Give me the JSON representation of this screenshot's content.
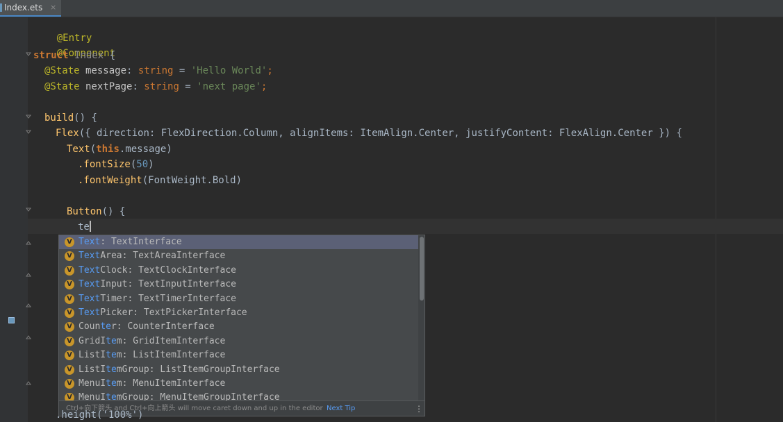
{
  "tab": {
    "filename": "Index.ets",
    "close": "×"
  },
  "code": {
    "line1": "@Entry",
    "line2": "@Component",
    "struct_kw": "struct",
    "struct_name": "Index",
    "struct_open": " {",
    "state_decorator": "@State",
    "message_name": " message",
    "colon_string": ": ",
    "string_type": "string",
    "eq": " = ",
    "message_value": "'Hello World'",
    "semicolon": ";",
    "next_name": " nextPage",
    "next_value": "'next page'",
    "build_fn": "build",
    "build_rest": "() {",
    "flex_line": {
      "flex": "Flex",
      "open": "({ ",
      "direction_key": "direction",
      "direction_val": ": FlexDirection.Column, ",
      "align_key": "alignItems",
      "align_val": ": ItemAlign.Center, ",
      "justify_key": "justifyContent",
      "justify_val": ": FlexAlign.Center ",
      "close": "}) {"
    },
    "text_fn": "Text",
    "text_open": "(",
    "this_kw": "this",
    "text_arg": ".message)",
    "font_size_fn": ".fontSize",
    "font_size_open": "(",
    "font_size_val": "50",
    "font_size_close": ")",
    "font_weight_fn": ".fontWeight",
    "font_weight_arg": "(FontWeight.Bold)",
    "button_fn": "Button",
    "button_rest": "() {",
    "typed": "te",
    "partial_line": ".height('100%')"
  },
  "completion": {
    "items": [
      {
        "match": "Text",
        "rest": ": TextInterface"
      },
      {
        "match": "Text",
        "rest": "Area: TextAreaInterface"
      },
      {
        "match": "Text",
        "rest": "Clock: TextClockInterface"
      },
      {
        "match": "Text",
        "rest": "Input: TextInputInterface"
      },
      {
        "match": "Text",
        "rest": "Timer: TextTimerInterface"
      },
      {
        "match": "Text",
        "rest": "Picker: TextPickerInterface"
      },
      {
        "pre": "Coun",
        "match": "te",
        "rest": "r: CounterInterface"
      },
      {
        "pre": "GridI",
        "match": "te",
        "rest": "m: GridItemInterface"
      },
      {
        "pre": "ListI",
        "match": "te",
        "rest": "m: ListItemInterface"
      },
      {
        "pre": "ListI",
        "match": "te",
        "rest": "mGroup: ListItemGroupInterface"
      },
      {
        "pre": "MenuI",
        "match": "te",
        "rest": "m: MenuItemInterface"
      },
      {
        "pre": "MenuI",
        "match": "te",
        "rest": "mGroup: MenuItemGroupInterface"
      }
    ],
    "icon_letter": "V",
    "footer_hint": "Ctrl+向下箭头 and Ctrl+向上箭头 will move caret down and up in the editor",
    "footer_link": "Next Tip",
    "footer_more": "⋮"
  },
  "colors": {
    "editor_bg": "#2b2b2b",
    "keyword": "#cc7832",
    "string": "#6a8759",
    "number": "#6897bb",
    "function": "#ffc66d",
    "annotation": "#bbb529",
    "match_highlight": "#589df6"
  }
}
